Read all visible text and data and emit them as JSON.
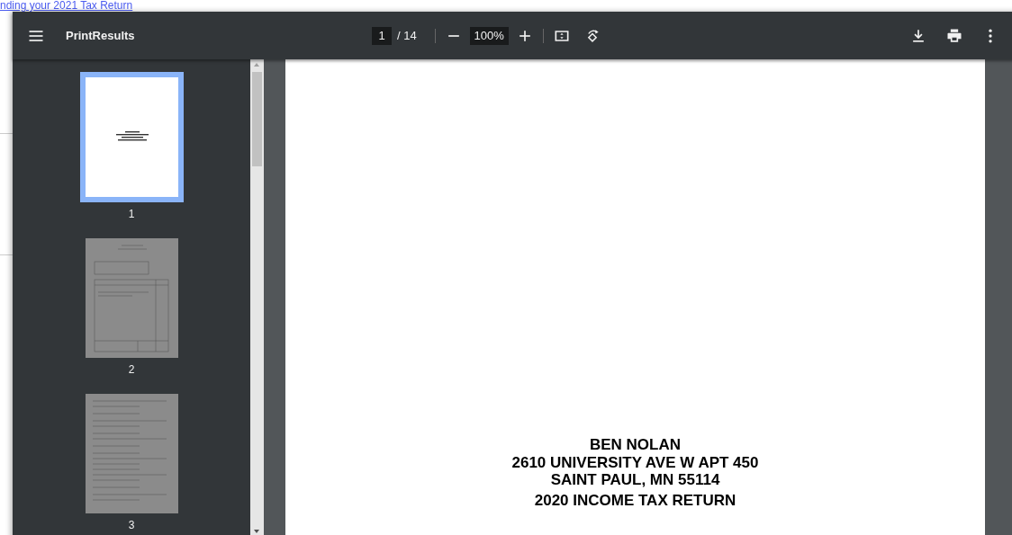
{
  "background_link": "nding your 2021 Tax Return",
  "toolbar": {
    "title": "PrintResults",
    "page_input": "1",
    "page_count": "/ 14",
    "zoom": "100%"
  },
  "thumbnails": [
    {
      "label": "1",
      "selected": true
    },
    {
      "label": "2",
      "selected": false
    },
    {
      "label": "3",
      "selected": false
    }
  ],
  "page": {
    "lines": [
      "BEN NOLAN",
      "2610 UNIVERSITY AVE W APT 450",
      "SAINT PAUL, MN 55114",
      "2020 INCOME TAX RETURN"
    ]
  }
}
